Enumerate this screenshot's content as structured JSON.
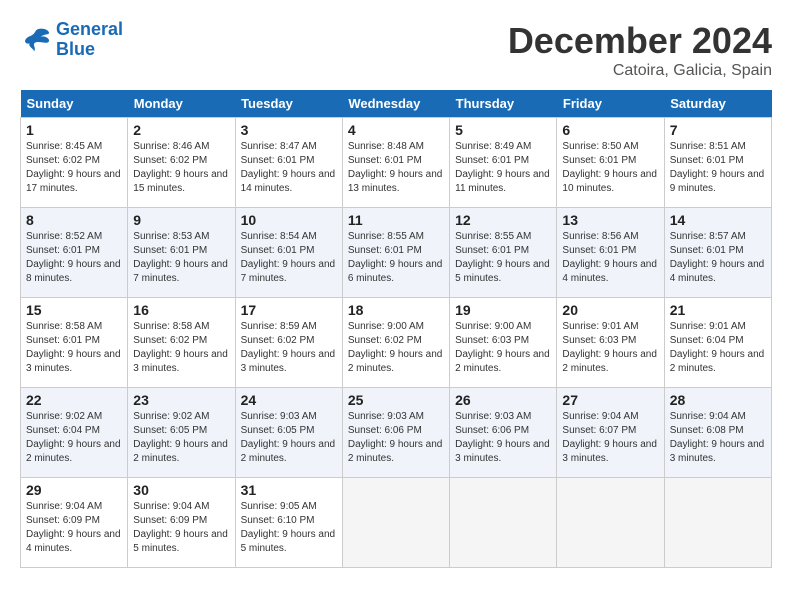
{
  "header": {
    "logo_line1": "General",
    "logo_line2": "Blue",
    "month": "December 2024",
    "location": "Catoira, Galicia, Spain"
  },
  "weekdays": [
    "Sunday",
    "Monday",
    "Tuesday",
    "Wednesday",
    "Thursday",
    "Friday",
    "Saturday"
  ],
  "weeks": [
    [
      {
        "day": "1",
        "sunrise": "8:45 AM",
        "sunset": "6:02 PM",
        "daylight": "9 hours and 17 minutes."
      },
      {
        "day": "2",
        "sunrise": "8:46 AM",
        "sunset": "6:02 PM",
        "daylight": "9 hours and 15 minutes."
      },
      {
        "day": "3",
        "sunrise": "8:47 AM",
        "sunset": "6:01 PM",
        "daylight": "9 hours and 14 minutes."
      },
      {
        "day": "4",
        "sunrise": "8:48 AM",
        "sunset": "6:01 PM",
        "daylight": "9 hours and 13 minutes."
      },
      {
        "day": "5",
        "sunrise": "8:49 AM",
        "sunset": "6:01 PM",
        "daylight": "9 hours and 11 minutes."
      },
      {
        "day": "6",
        "sunrise": "8:50 AM",
        "sunset": "6:01 PM",
        "daylight": "9 hours and 10 minutes."
      },
      {
        "day": "7",
        "sunrise": "8:51 AM",
        "sunset": "6:01 PM",
        "daylight": "9 hours and 9 minutes."
      }
    ],
    [
      {
        "day": "8",
        "sunrise": "8:52 AM",
        "sunset": "6:01 PM",
        "daylight": "9 hours and 8 minutes."
      },
      {
        "day": "9",
        "sunrise": "8:53 AM",
        "sunset": "6:01 PM",
        "daylight": "9 hours and 7 minutes."
      },
      {
        "day": "10",
        "sunrise": "8:54 AM",
        "sunset": "6:01 PM",
        "daylight": "9 hours and 7 minutes."
      },
      {
        "day": "11",
        "sunrise": "8:55 AM",
        "sunset": "6:01 PM",
        "daylight": "9 hours and 6 minutes."
      },
      {
        "day": "12",
        "sunrise": "8:55 AM",
        "sunset": "6:01 PM",
        "daylight": "9 hours and 5 minutes."
      },
      {
        "day": "13",
        "sunrise": "8:56 AM",
        "sunset": "6:01 PM",
        "daylight": "9 hours and 4 minutes."
      },
      {
        "day": "14",
        "sunrise": "8:57 AM",
        "sunset": "6:01 PM",
        "daylight": "9 hours and 4 minutes."
      }
    ],
    [
      {
        "day": "15",
        "sunrise": "8:58 AM",
        "sunset": "6:01 PM",
        "daylight": "9 hours and 3 minutes."
      },
      {
        "day": "16",
        "sunrise": "8:58 AM",
        "sunset": "6:02 PM",
        "daylight": "9 hours and 3 minutes."
      },
      {
        "day": "17",
        "sunrise": "8:59 AM",
        "sunset": "6:02 PM",
        "daylight": "9 hours and 3 minutes."
      },
      {
        "day": "18",
        "sunrise": "9:00 AM",
        "sunset": "6:02 PM",
        "daylight": "9 hours and 2 minutes."
      },
      {
        "day": "19",
        "sunrise": "9:00 AM",
        "sunset": "6:03 PM",
        "daylight": "9 hours and 2 minutes."
      },
      {
        "day": "20",
        "sunrise": "9:01 AM",
        "sunset": "6:03 PM",
        "daylight": "9 hours and 2 minutes."
      },
      {
        "day": "21",
        "sunrise": "9:01 AM",
        "sunset": "6:04 PM",
        "daylight": "9 hours and 2 minutes."
      }
    ],
    [
      {
        "day": "22",
        "sunrise": "9:02 AM",
        "sunset": "6:04 PM",
        "daylight": "9 hours and 2 minutes."
      },
      {
        "day": "23",
        "sunrise": "9:02 AM",
        "sunset": "6:05 PM",
        "daylight": "9 hours and 2 minutes."
      },
      {
        "day": "24",
        "sunrise": "9:03 AM",
        "sunset": "6:05 PM",
        "daylight": "9 hours and 2 minutes."
      },
      {
        "day": "25",
        "sunrise": "9:03 AM",
        "sunset": "6:06 PM",
        "daylight": "9 hours and 2 minutes."
      },
      {
        "day": "26",
        "sunrise": "9:03 AM",
        "sunset": "6:06 PM",
        "daylight": "9 hours and 3 minutes."
      },
      {
        "day": "27",
        "sunrise": "9:04 AM",
        "sunset": "6:07 PM",
        "daylight": "9 hours and 3 minutes."
      },
      {
        "day": "28",
        "sunrise": "9:04 AM",
        "sunset": "6:08 PM",
        "daylight": "9 hours and 3 minutes."
      }
    ],
    [
      {
        "day": "29",
        "sunrise": "9:04 AM",
        "sunset": "6:09 PM",
        "daylight": "9 hours and 4 minutes."
      },
      {
        "day": "30",
        "sunrise": "9:04 AM",
        "sunset": "6:09 PM",
        "daylight": "9 hours and 5 minutes."
      },
      {
        "day": "31",
        "sunrise": "9:05 AM",
        "sunset": "6:10 PM",
        "daylight": "9 hours and 5 minutes."
      },
      null,
      null,
      null,
      null
    ]
  ],
  "labels": {
    "sunrise": "Sunrise:",
    "sunset": "Sunset:",
    "daylight": "Daylight:"
  }
}
